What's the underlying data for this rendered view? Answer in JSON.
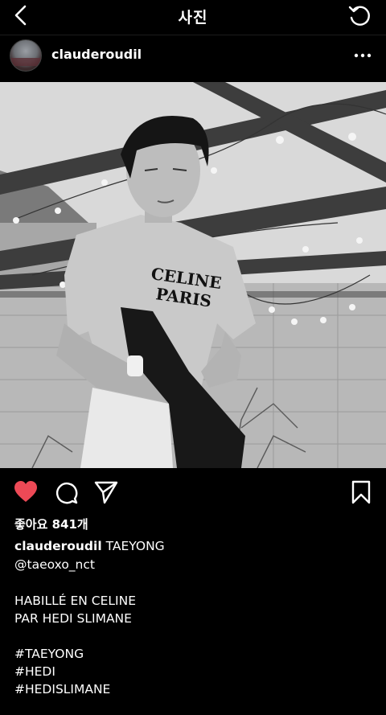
{
  "topbar": {
    "title": "사진"
  },
  "post": {
    "username": "clauderoudil",
    "likes_text": "좋아요 841개",
    "caption_author": "clauderoudil",
    "caption_text": "TAEYONG",
    "mention": "@taeoxo_nct",
    "line_1": "HABILLÉ EN CELINE",
    "line_2": "PAR HEDI SLIMANE",
    "hashtags": [
      "#TAEYONG",
      "#HEDI",
      "#HEDISLIMANE"
    ]
  },
  "photo": {
    "shirt_text_1": "CELINE",
    "shirt_text_2": "PARIS"
  },
  "colors": {
    "background": "#000000",
    "like": "#ed4956"
  },
  "icons": {
    "back": "back-chevron-icon",
    "refresh": "refresh-icon",
    "more": "more-dots-icon",
    "like": "heart-filled-icon",
    "comment": "comment-icon",
    "share": "share-icon",
    "save": "bookmark-icon"
  }
}
